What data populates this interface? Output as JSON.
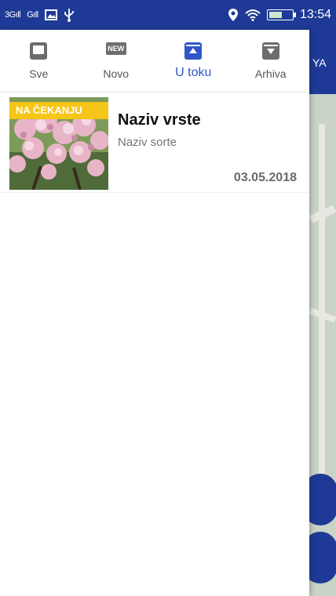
{
  "status_bar": {
    "signal_left": "3Gıll",
    "signal_right": "Gıll",
    "time": "13:54"
  },
  "background_app": {
    "header_text": "YA"
  },
  "tabs": [
    {
      "label": "Sve",
      "icon": "inbox-icon",
      "active": false
    },
    {
      "label": "Novo",
      "icon": "new-badge-icon",
      "icon_text": "NEW",
      "active": false
    },
    {
      "label": "U toku",
      "icon": "archive-up-icon",
      "active": true
    },
    {
      "label": "Arhiva",
      "icon": "archive-down-icon",
      "active": false
    }
  ],
  "items": [
    {
      "badge": "NA ČEKANJU",
      "title": "Naziv vrste",
      "subtitle": "Naziv sorte",
      "date": "03.05.2018"
    }
  ],
  "colors": {
    "primary": "#1e3a96",
    "accent": "#2f57c9",
    "badge": "#f5c518"
  }
}
